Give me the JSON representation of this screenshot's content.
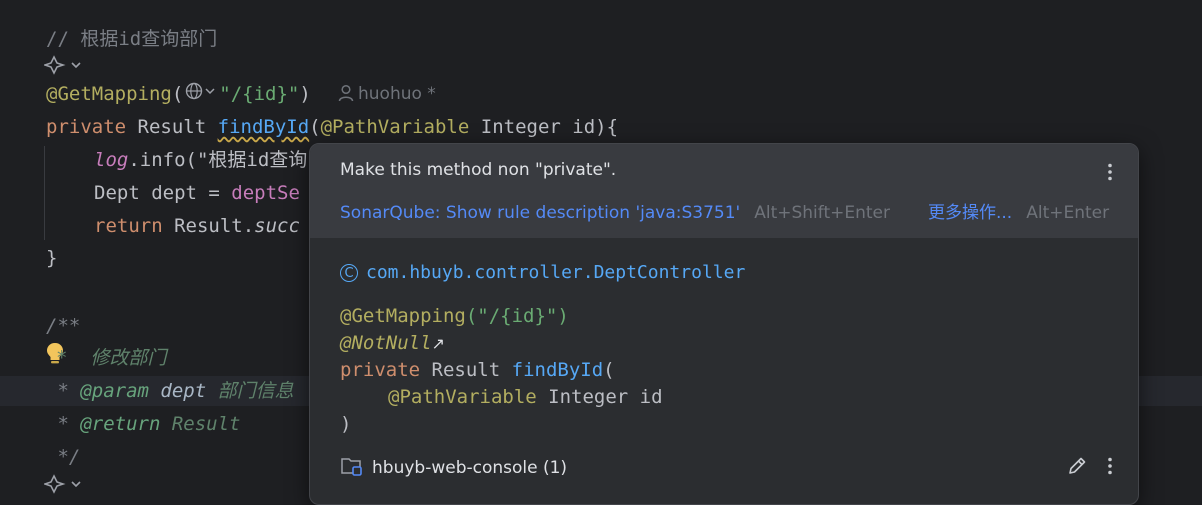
{
  "editor": {
    "comment_find": "// 根据id查询部门",
    "annotation_get": "@GetMapping",
    "path_literal": "\"/{id}\"",
    "author_hint": "huohuo *",
    "kw_private": "private",
    "type_result": "Result",
    "method_find": "findById",
    "param_annotation": "@PathVariable",
    "param_type_name": "Integer id){",
    "log_obj": "log",
    "log_call": ".info(\"根据id查询",
    "dept_decl": "Dept dept = ",
    "dept_service": "deptSe",
    "kw_return": "return",
    "return_expr": "Result.",
    "return_call": "succ",
    "close_brace": "}",
    "javadoc_open": "/**",
    "javadoc_line1": "*  修改部门",
    "javadoc_param_star": " * ",
    "javadoc_param_tag": "@param",
    "javadoc_param_name": "dept",
    "javadoc_param_desc": "部门信息",
    "javadoc_return_star": " * ",
    "javadoc_return_tag": "@return",
    "javadoc_return_type": "Result",
    "javadoc_close": " */"
  },
  "popup": {
    "title": "Make this method non \"private\".",
    "action_link": "SonarQube: Show rule description 'java:S3751'",
    "action_shortcut": "Alt+Shift+Enter",
    "more_actions": "更多操作...",
    "more_shortcut": "Alt+Enter",
    "doc_class_icon": "C",
    "doc_class": "com.hbuyb.controller.DeptController",
    "doc_annotation": "@GetMapping",
    "doc_annotation_arg": "(\"/{id}\")",
    "doc_notnull": "@NotNull",
    "doc_notnull_arrow": "↗",
    "doc_private": "private",
    "doc_result": "Result",
    "doc_method": "findById",
    "doc_paren_open": "(",
    "doc_param_annotation": "@PathVariable",
    "doc_param_rest": "Integer id",
    "doc_paren_close": ")",
    "footer_module": "hbuyb-web-console (1)"
  },
  "icons": {
    "gutter_ai": "ai-sparkle-icon",
    "globe": "globe-icon",
    "person": "person-icon",
    "bulb": "lightbulb-icon",
    "kebab": "kebab-menu-icon",
    "edit": "pencil-icon",
    "module": "module-folder-icon"
  },
  "colors": {
    "background": "#1e1f22",
    "popup_bg": "#2b2d30",
    "popup_header": "#393b40",
    "link": "#548af7",
    "keyword": "#cf8e6d",
    "annotation": "#b3ae60",
    "string": "#6aab73",
    "method": "#56a8f5"
  }
}
